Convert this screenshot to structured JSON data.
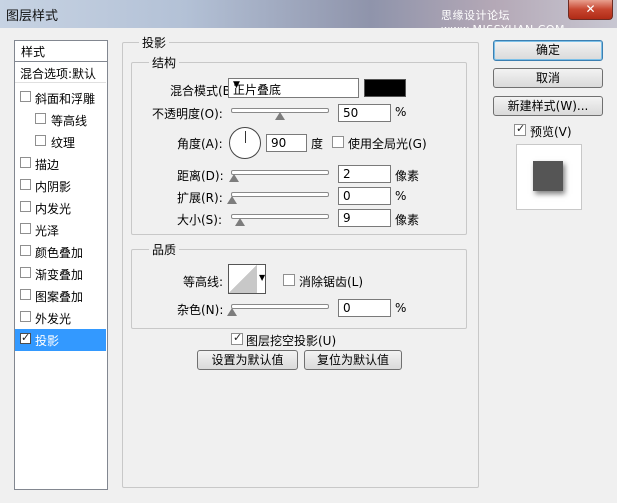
{
  "window": {
    "title": "图层样式",
    "watermark": "思缘设计论坛 www.MISSYUAN.COM",
    "close_symbol": "✕"
  },
  "sidebar": {
    "header": "样式",
    "blend_default": "混合选项:默认",
    "items": [
      {
        "label": "斜面和浮雕",
        "checked": false
      },
      {
        "label": "等高线",
        "checked": false,
        "sub": true
      },
      {
        "label": "纹理",
        "checked": false,
        "sub": true
      },
      {
        "label": "描边",
        "checked": false
      },
      {
        "label": "内阴影",
        "checked": false
      },
      {
        "label": "内发光",
        "checked": false
      },
      {
        "label": "光泽",
        "checked": false
      },
      {
        "label": "颜色叠加",
        "checked": false
      },
      {
        "label": "渐变叠加",
        "checked": false
      },
      {
        "label": "图案叠加",
        "checked": false
      },
      {
        "label": "外发光",
        "checked": false
      },
      {
        "label": "投影",
        "checked": true,
        "selected": true
      }
    ]
  },
  "drop_shadow": {
    "title": "投影",
    "structure": {
      "title": "结构",
      "blend_mode_label": "混合模式(B):",
      "blend_mode_value": "正片叠底",
      "color": "#000000",
      "opacity_label": "不透明度(O):",
      "opacity_value": "50",
      "opacity_unit": "%",
      "opacity_level": 0.5,
      "angle_label": "角度(A):",
      "angle_value": "90",
      "angle_unit": "度",
      "global_light_label": "使用全局光(G)",
      "global_light_checked": false,
      "distance_label": "距离(D):",
      "distance_value": "2",
      "distance_unit": "像素",
      "spread_label": "扩展(R):",
      "spread_value": "0",
      "spread_unit": "%",
      "size_label": "大小(S):",
      "size_value": "9",
      "size_unit": "像素"
    },
    "quality": {
      "title": "品质",
      "contour_label": "等高线:",
      "antialias_label": "消除锯齿(L)",
      "antialias_checked": false,
      "noise_label": "杂色(N):",
      "noise_value": "0",
      "noise_unit": "%"
    },
    "knockout_label": "图层挖空投影(U)",
    "knockout_checked": true,
    "set_default": "设置为默认值",
    "reset_default": "复位为默认值"
  },
  "right_panel": {
    "ok": "确定",
    "cancel": "取消",
    "new_style": "新建样式(W)...",
    "preview_label": "预览(V)",
    "preview_checked": true
  },
  "colors": {
    "selection": "#3399ff",
    "shadow_color": "#000000"
  }
}
